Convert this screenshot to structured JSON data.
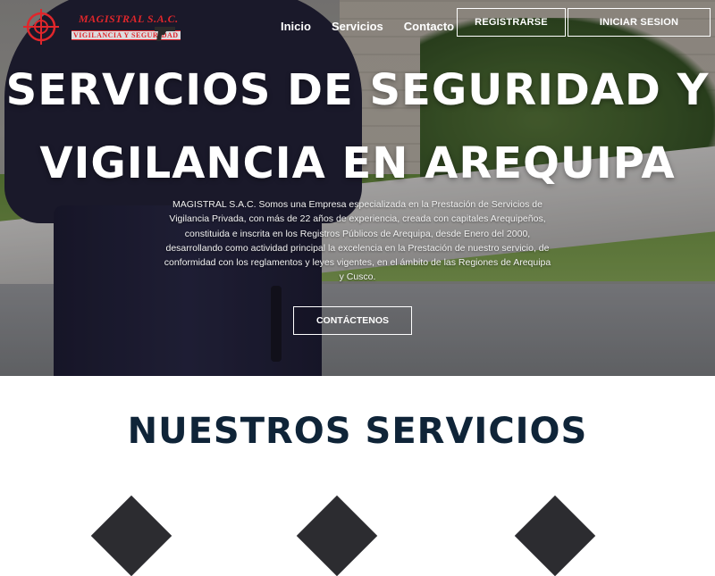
{
  "logo": {
    "title": "MAGISTRAL S.A.C.",
    "subtitle": "VIGILANCIA Y SEGURIDAD",
    "icon": "crosshair-icon",
    "accent": "#e0262b"
  },
  "nav": {
    "items": [
      {
        "label": "Inicio"
      },
      {
        "label": "Servicios"
      },
      {
        "label": "Contacto"
      }
    ],
    "register_label": "REGISTRARSE",
    "login_label": "INICIAR SESION"
  },
  "hero": {
    "title_line1": "SERVICIOS DE SEGURIDAD Y",
    "title_line2": "VIGILANCIA EN AREQUIPA",
    "description": "MAGISTRAL S.A.C. Somos una Empresa especializada en la Prestación de Servicios de Vigilancia Privada, con más de 22 años de experiencia, creada con capitales Arequipeños, constituida e inscrita en los Registros Públicos de Arequipa, desde Enero del 2000, desarrollando como actividad principal la excelencia en la Prestación de nuestro servicio, de conformidad con los reglamentos y leyes vigentes, en el ámbito de las Regiones de Arequipa y Cusco.",
    "cta_label": "CONTÁCTENOS"
  },
  "services": {
    "title": "NUESTROS SERVICIOS",
    "title_color": "#0f2438"
  }
}
